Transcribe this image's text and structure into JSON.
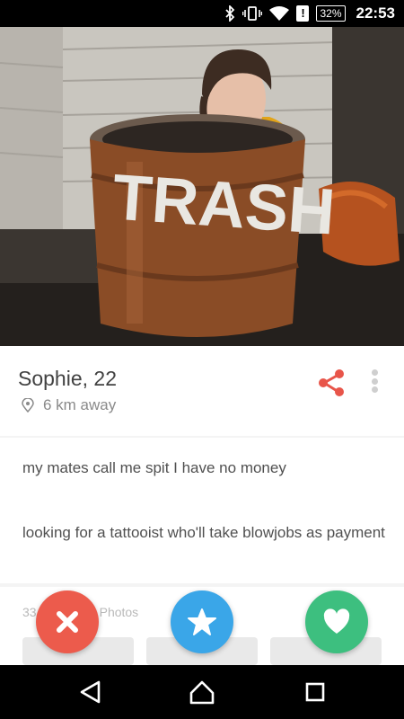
{
  "status_bar": {
    "battery": "32%",
    "time": "22:53",
    "icons": [
      "bluetooth-icon",
      "vibrate-icon",
      "wifi-icon",
      "alert-icon",
      "battery-icon"
    ]
  },
  "photo": {
    "painted_text": "TRASH"
  },
  "profile": {
    "name_age": "Sophie, 22",
    "distance": "6 km away"
  },
  "bio": {
    "line1": "my mates call me spit I have no money",
    "line2": "looking for a tattooist who'll take blowjobs as payment"
  },
  "instagram": {
    "label": "33 Instagram Photos"
  },
  "actions": {
    "dislike_icon": "close-icon",
    "superlike_icon": "star-icon",
    "like_icon": "heart-icon"
  },
  "colors": {
    "share": "#e8554a",
    "dislike": "#ec5b4c",
    "superlike": "#3aa6e8",
    "like": "#3dbf7f"
  },
  "navbar": {
    "icons": [
      "back-icon",
      "home-icon",
      "recents-icon"
    ]
  }
}
